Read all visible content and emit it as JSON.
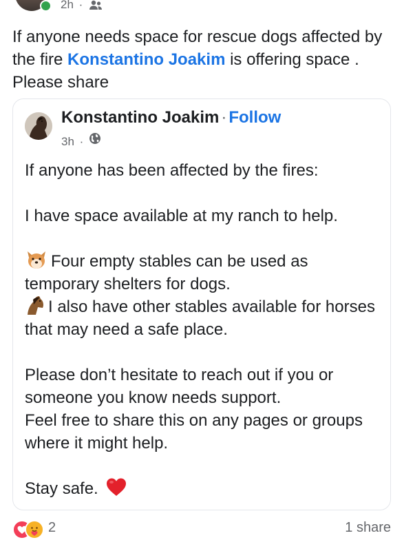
{
  "author_post": {
    "time": "2h",
    "audience_icon": "friends-icon",
    "text_before": "If anyone needs space for rescue dogs affected by the fire ",
    "mention": "Konstantino Joakim",
    "text_after": " is offering space . Please share"
  },
  "shared_post": {
    "author": "Konstantino Joakim",
    "follow_label": "Follow",
    "time": "3h",
    "audience_icon": "globe-icon",
    "line1": "If anyone has been affected by the fires:",
    "line2": "I have space available at my ranch to help.",
    "line3": "Four empty stables can be used as temporary shelters for dogs.",
    "line4": "I also have other stables available for horses that may need a safe place.",
    "line5": "Please don’t hesitate to reach out if you or someone you know needs support.",
    "line6": "Feel free to share this on any pages or groups where it might help.",
    "line7": "Stay safe."
  },
  "engagement": {
    "reaction_count": "2",
    "shares": "1 share"
  },
  "colors": {
    "link": "#1b74e4",
    "secondary_text": "#65676b",
    "online": "#31a24c",
    "love": "#f33e58",
    "care": "#f7b125"
  }
}
